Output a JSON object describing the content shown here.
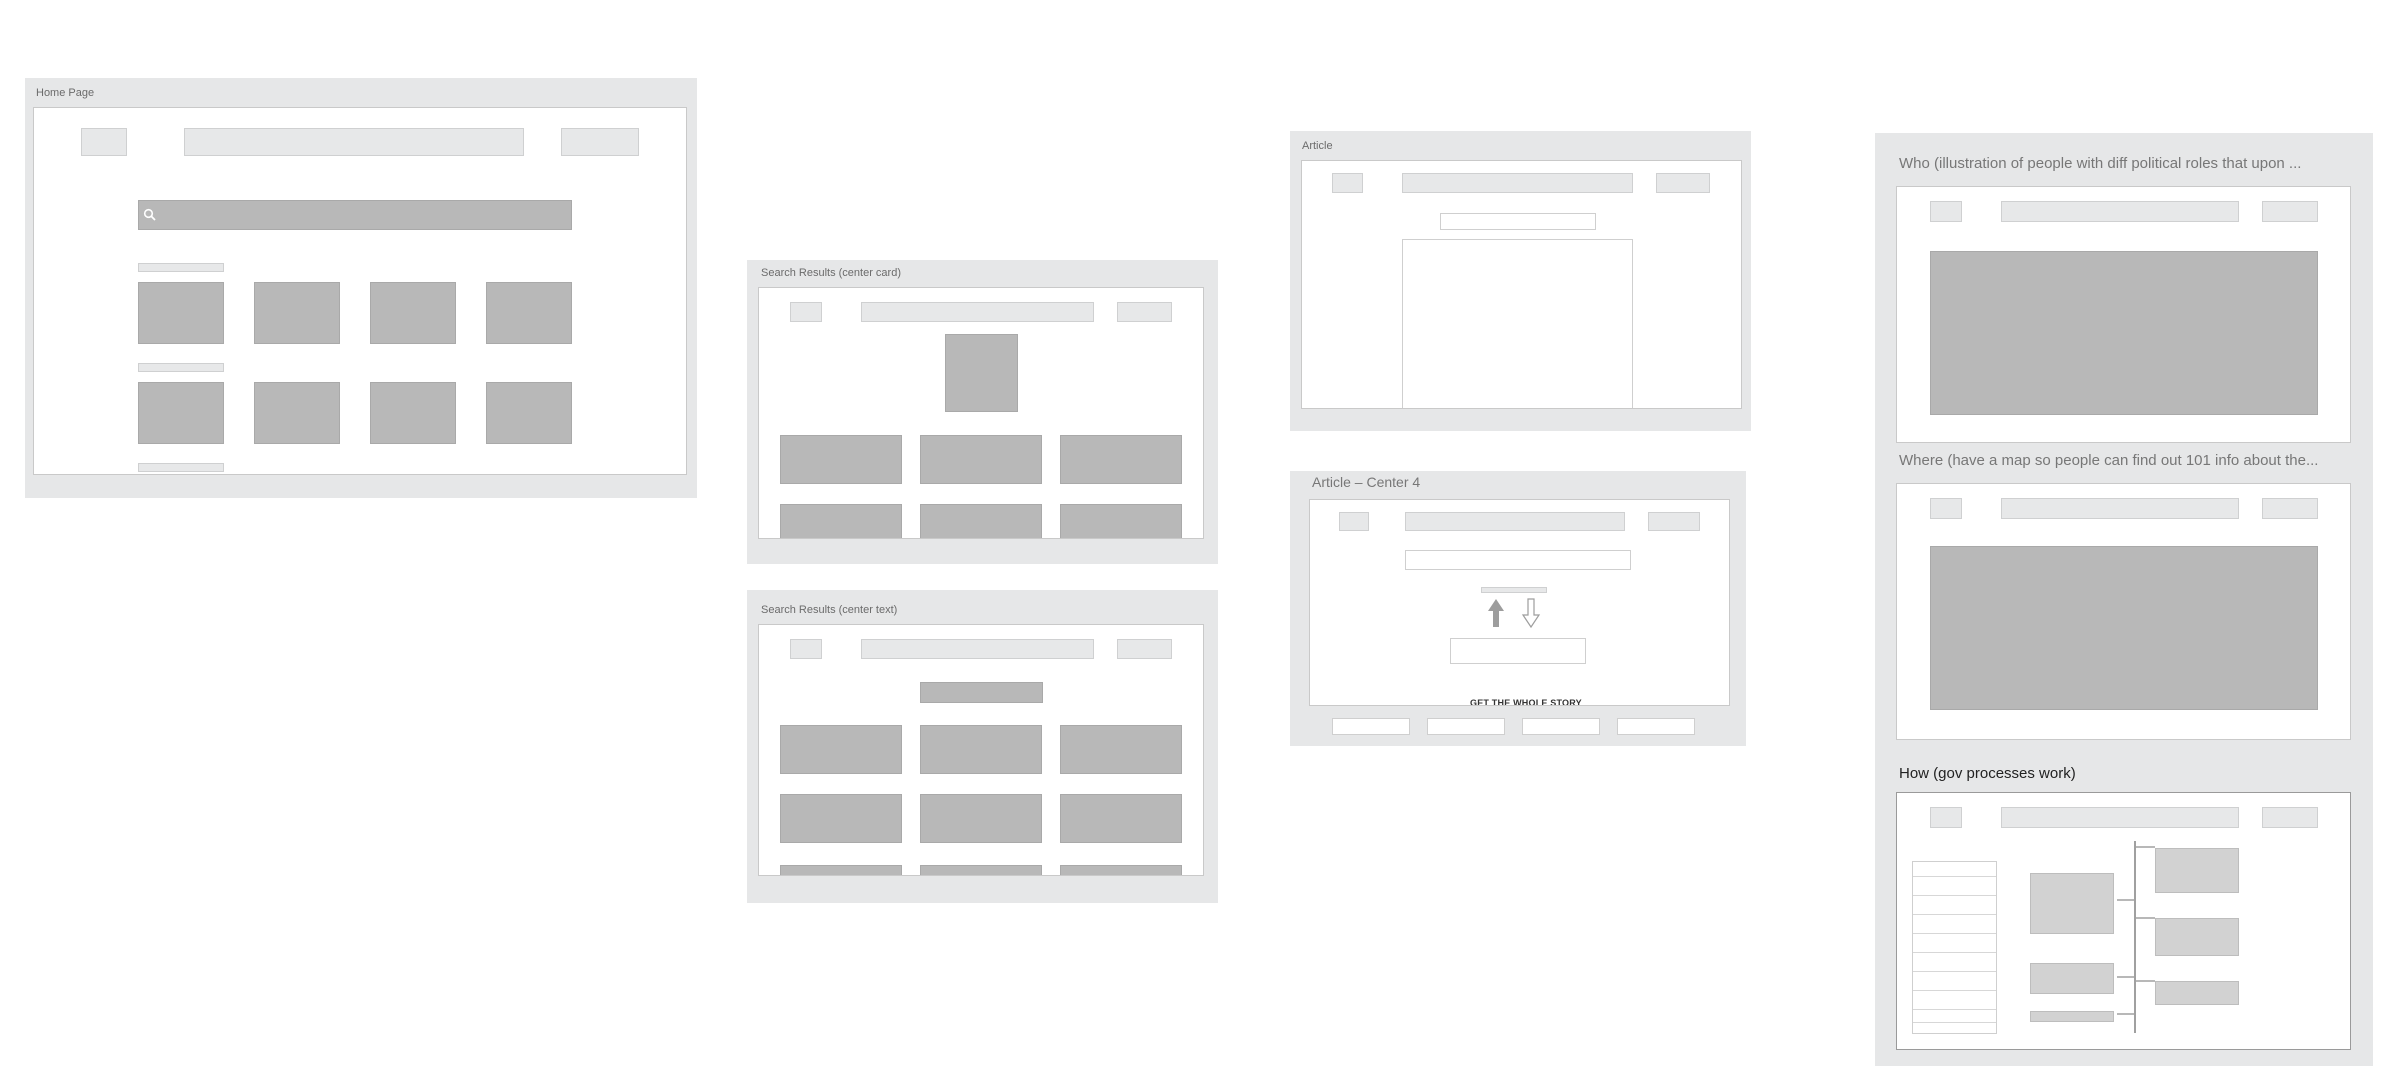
{
  "frames": {
    "home": {
      "title": "Home Page"
    },
    "search_card": {
      "title": "Search Results (center card)"
    },
    "search_text": {
      "title": "Search Results (center text)"
    },
    "article": {
      "title": "Article"
    },
    "article_center4": {
      "title": "Article – Center 4",
      "cta_label": "GET THE WHOLE STORY"
    },
    "who": {
      "title": "Who (illustration of people with diff political roles that upon ..."
    },
    "where": {
      "title": "Where (have a map so people can find out 101 info about the..."
    },
    "how": {
      "title": "How (gov processes work)"
    }
  },
  "icons": [
    "search-icon",
    "arrow-up-icon",
    "arrow-down-icon"
  ],
  "colors": {
    "canvas": "#ffffff",
    "frame": "#e6e7e8",
    "placeholder_dark": "#b8b8b8",
    "placeholder_light": "#e7e8e9"
  }
}
